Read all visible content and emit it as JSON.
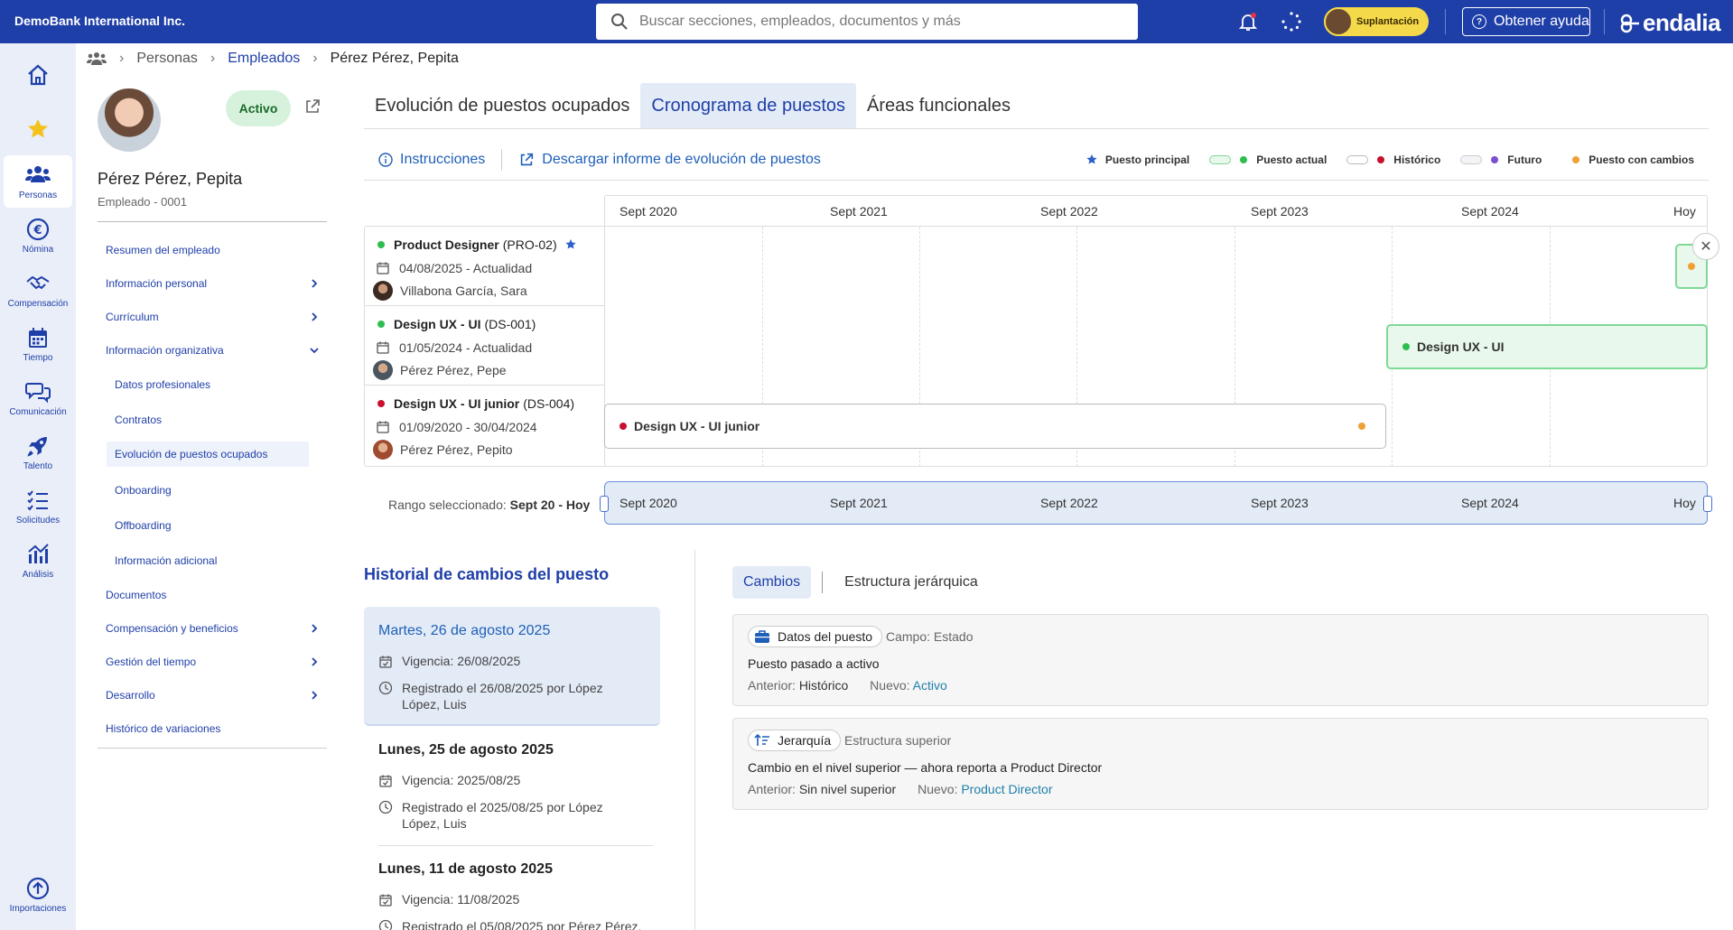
{
  "topbar": {
    "company": "DemoBank International Inc.",
    "search_placeholder": "Buscar secciones, empleados, documentos y más",
    "impersonate_label": "Suplantación",
    "help_label": "Obtener ayuda",
    "logo_text": "endalia"
  },
  "nav": [
    {
      "label": "",
      "icon": "home-icon"
    },
    {
      "label": "",
      "icon": "star-icon"
    },
    {
      "label": "Personas",
      "icon": "people-icon"
    },
    {
      "label": "Nómina",
      "icon": "euro-icon"
    },
    {
      "label": "Compensación",
      "icon": "handshake-icon"
    },
    {
      "label": "Tiempo",
      "icon": "calendar-icon"
    },
    {
      "label": "Comunicación",
      "icon": "chat-icon"
    },
    {
      "label": "Talento",
      "icon": "rocket-icon"
    },
    {
      "label": "Solicitudes",
      "icon": "checklist-icon"
    },
    {
      "label": "Análisis",
      "icon": "chart-icon"
    },
    {
      "label": "Importaciones",
      "icon": "upload-icon"
    }
  ],
  "breadcrumb": {
    "personas": "Personas",
    "empleados": "Empleados",
    "current": "Pérez Pérez, Pepita"
  },
  "employee": {
    "status": "Activo",
    "name": "Pérez Pérez, Pepita",
    "subtitle": "Empleado - 0001"
  },
  "menu": [
    "Resumen del empleado",
    "Información personal",
    "Currículum",
    "Información organizativa",
    "Datos profesionales",
    "Contratos",
    "Evolución de puestos ocupados",
    "Onboarding",
    "Offboarding",
    "Información adicional",
    "Documentos",
    "Compensación y beneficios",
    "Gestión del tiempo",
    "Desarrollo",
    "Histórico de variaciones"
  ],
  "tabs": [
    "Evolución de puestos ocupados",
    "Cronograma de puestos",
    "Áreas funcionales"
  ],
  "toolbar": {
    "instructions": "Instrucciones",
    "download": "Descargar informe de evolución de puestos"
  },
  "legend": {
    "principal": "Puesto principal",
    "actual": "Puesto actual",
    "historico": "Histórico",
    "futuro": "Futuro",
    "cambios": "Puesto con cambios",
    "colors": {
      "actual": "#2ebd4f",
      "historico": "#c8102e",
      "futuro": "#7a4fd0",
      "cambios": "#f0a035",
      "star": "#2e5fc9"
    }
  },
  "timeline": {
    "ticks": [
      "Sept 2020",
      "Sept 2021",
      "Sept 2022",
      "Sept 2023",
      "Sept 2024",
      "Hoy"
    ],
    "rows": [
      {
        "title": "Product Designer",
        "code": "(PRO-02)",
        "dates": "04/08/2025 - Actualidad",
        "person": "Villabona García, Sara"
      },
      {
        "title": "Design UX - UI",
        "code": "(DS-001)",
        "dates": "01/05/2024 - Actualidad",
        "person": "Pérez Pérez, Pepe"
      },
      {
        "title": "Design UX - UI junior",
        "code": "(DS-004)",
        "dates": "01/09/2020 - 30/04/2024",
        "person": "Pérez Pérez, Pepito"
      }
    ],
    "bars": {
      "row2": "Design UX - UI",
      "row3": "Design UX - UI junior"
    },
    "range_label": "Rango seleccionado:",
    "range_value": "Sept 20  - Hoy"
  },
  "history": {
    "title": "Historial de cambios del puesto",
    "entries": [
      {
        "date": "Martes, 26 de agosto 2025",
        "vigencia": "Vigencia: 26/08/2025",
        "registro": "Registrado el 26/08/2025 por López López, Luis"
      },
      {
        "date": "Lunes, 25 de agosto 2025",
        "vigencia": "Vigencia: 2025/08/25",
        "registro": "Registrado el 2025/08/25 por López López, Luis"
      },
      {
        "date": "Lunes, 11 de agosto 2025",
        "vigencia": "Vigencia: 11/08/2025",
        "registro": "Registrado el 05/08/2025 por Pérez Pérez,"
      }
    ]
  },
  "changes": {
    "tabs": [
      "Cambios",
      "Estructura jerárquica"
    ],
    "cards": [
      {
        "chip": "Datos del puesto",
        "field": "Campo: Estado",
        "desc": "Puesto pasado a activo",
        "prev_label": "Anterior:",
        "prev": "Histórico",
        "new_label": "Nuevo:",
        "new": "Activo"
      },
      {
        "chip": "Jerarquía",
        "field": "Estructura superior",
        "desc": "Cambio en el nivel superior — ahora reporta a Product Director",
        "prev_label": "Anterior:",
        "prev": "Sin nivel superior",
        "new_label": "Nuevo:",
        "new": "Product Director"
      }
    ]
  }
}
